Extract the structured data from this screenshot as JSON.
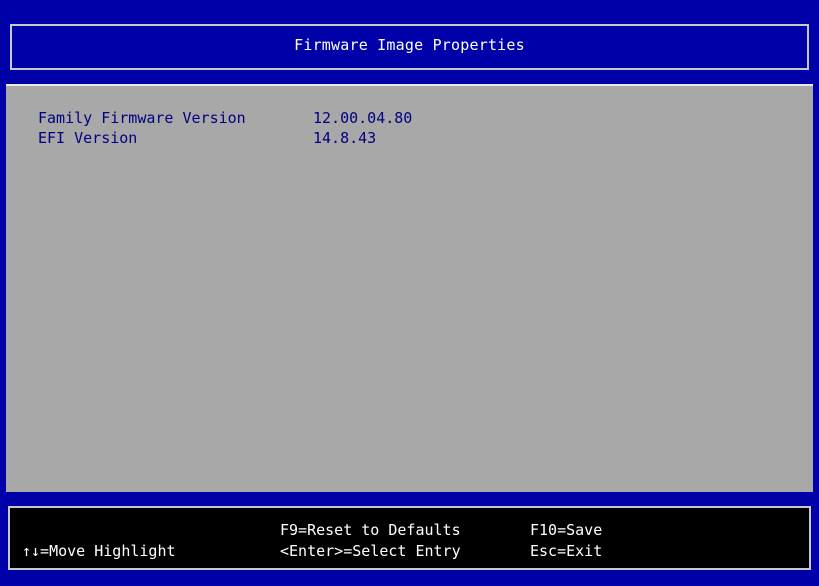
{
  "header": {
    "title": "Firmware Image Properties"
  },
  "properties": [
    {
      "label": "Family Firmware Version",
      "value": "12.00.04.80"
    },
    {
      "label": "EFI Version",
      "value": "14.8.43"
    }
  ],
  "footer": {
    "move_highlight": "↑↓=Move Highlight",
    "reset_defaults": "F9=Reset to Defaults",
    "select_entry": "<Enter>=Select Entry",
    "save": "F10=Save",
    "exit": "Esc=Exit"
  },
  "colors": {
    "header_bg": "#0000a8",
    "content_bg": "#a8a8a8",
    "text_blue": "#000080",
    "footer_bg": "#000000"
  }
}
